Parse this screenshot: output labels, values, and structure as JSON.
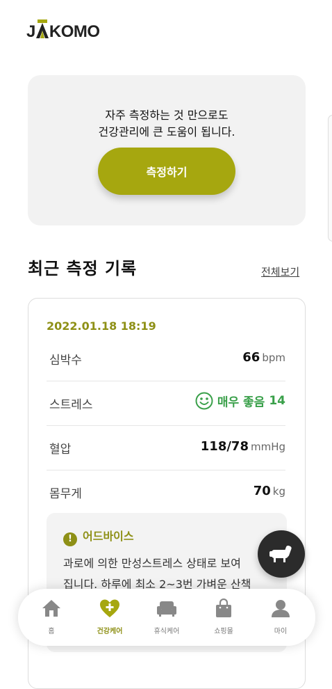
{
  "brand": {
    "logo_text": "JAKOMO"
  },
  "hero": {
    "line1": "자주 측정하는 것 만으로도",
    "line2": "건강관리에 큰 도움이 됩니다.",
    "button_label": "측정하기"
  },
  "recent": {
    "title": "최근 측정 기록",
    "view_all": "전체보기",
    "date": "2022.01.18 18:19",
    "rows": [
      {
        "label": "심박수",
        "value": "66",
        "unit": "bpm"
      },
      {
        "label": "스트레스",
        "status": "매우 좋음",
        "value": "14"
      },
      {
        "label": "혈압",
        "value": "118/78",
        "unit": "mmHg"
      },
      {
        "label": "몸무게",
        "value": "70",
        "unit": "kg"
      }
    ],
    "advice": {
      "title": "어드바이스",
      "line1": "과로에 의한 만성스트레스 상태로 보여",
      "line2": "집니다. 하루에 최소 2~3번 가벼운 산책"
    }
  },
  "nav": {
    "items": [
      {
        "label": "홈",
        "icon": "home-icon"
      },
      {
        "label": "건강케어",
        "icon": "heart-plus-icon",
        "active": true
      },
      {
        "label": "휴식케어",
        "icon": "sofa-icon"
      },
      {
        "label": "쇼핑몰",
        "icon": "shopping-bag-icon"
      },
      {
        "label": "마이",
        "icon": "user-icon"
      }
    ]
  },
  "colors": {
    "accent": "#a6a70f",
    "accent_text": "#8e9016",
    "good": "#3aa04a"
  }
}
